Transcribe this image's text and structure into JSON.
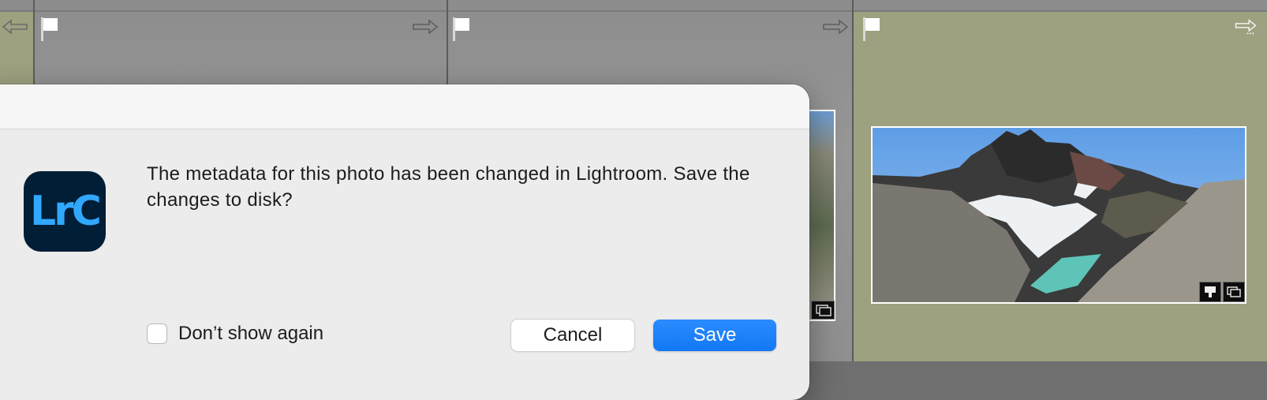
{
  "background": {
    "cell_colors": {
      "gray": "#909090",
      "selected": "#9ea17f"
    }
  },
  "dialog": {
    "app_icon_text": "LrC",
    "message": "The metadata for this photo has been changed in Lightroom. Save the changes to disk?",
    "checkbox_label": "Don’t show again",
    "checkbox_checked": false,
    "cancel_label": "Cancel",
    "save_label": "Save",
    "accent_color": "#1a7ff8"
  }
}
